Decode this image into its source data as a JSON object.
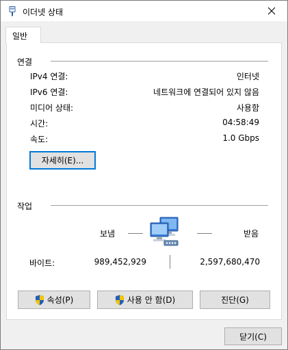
{
  "window": {
    "title": "이더넷 상태"
  },
  "tabs": [
    {
      "label": "일반"
    }
  ],
  "connection": {
    "section_title": "연결",
    "rows": [
      {
        "label": "IPv4 연결:",
        "value": "인터넷"
      },
      {
        "label": "IPv6 연결:",
        "value": "네트워크에 연결되어 있지 않음"
      },
      {
        "label": "미디어 상태:",
        "value": "사용함"
      },
      {
        "label": "시간:",
        "value": "04:58:49"
      },
      {
        "label": "속도:",
        "value": "1.0 Gbps"
      }
    ],
    "details_button": "자세히(E)..."
  },
  "activity": {
    "section_title": "작업",
    "sent_label": "보냄",
    "received_label": "받음",
    "bytes_label": "바이트:",
    "bytes_sent": "989,452,929",
    "bytes_received": "2,597,680,470"
  },
  "buttons": {
    "properties": "속성(P)",
    "disable": "사용 안 함(D)",
    "diagnose": "진단(G)",
    "close": "닫기(C)"
  },
  "colors": {
    "shield_blue": "#1f5fbf",
    "shield_yellow": "#f5c400",
    "focus": "#0078d7"
  },
  "icons": {
    "title": "ethernet-icon",
    "network": "network-computers-icon",
    "shield": "uac-shield-icon"
  }
}
